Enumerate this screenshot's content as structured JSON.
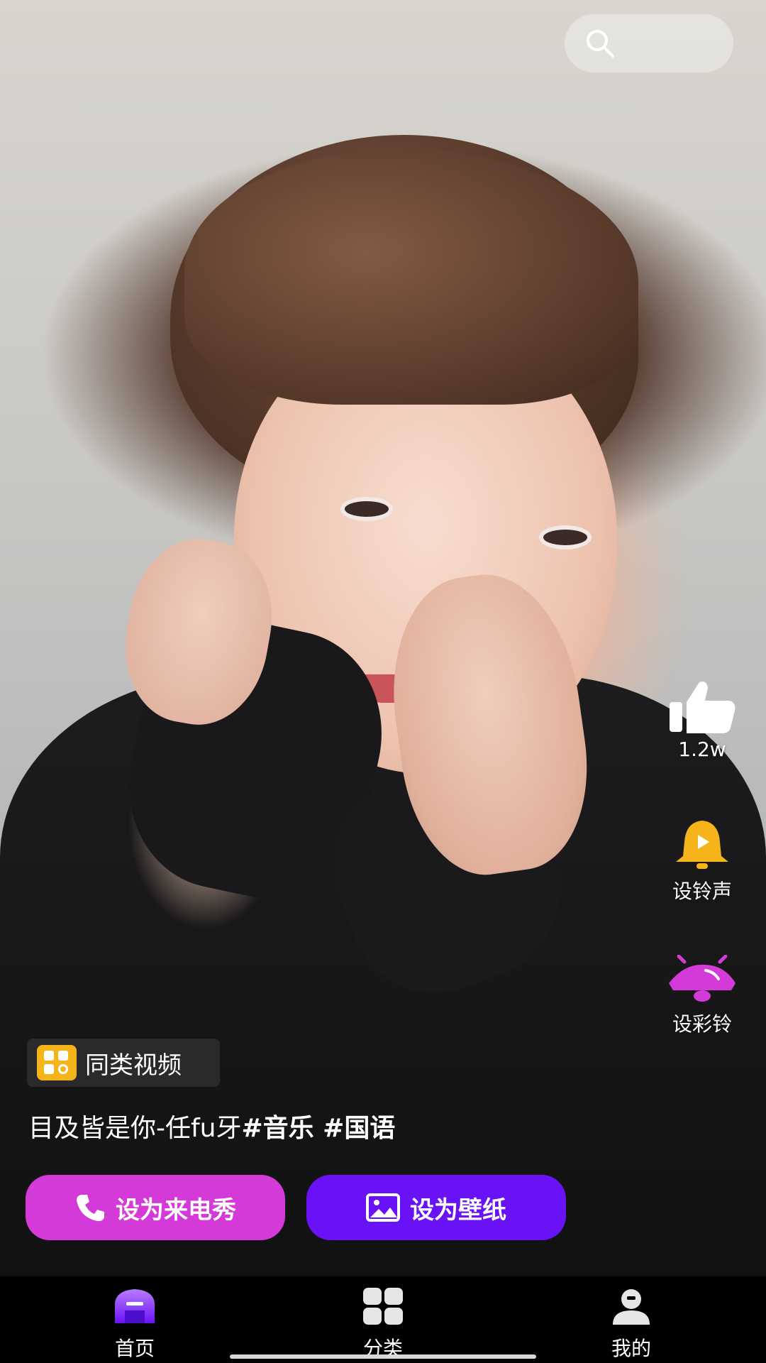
{
  "search": {
    "icon": "search-icon"
  },
  "actions": {
    "like": {
      "icon": "thumbs-up-icon",
      "count": "1.2w"
    },
    "ringtone": {
      "icon": "bell-play-icon",
      "label": "设铃声",
      "color": "#f5b51a"
    },
    "color_ring": {
      "icon": "ringing-bell-icon",
      "label": "设彩铃",
      "color": "#d43ad8"
    }
  },
  "tag": {
    "icon": "grid-icon",
    "label": "同类视频",
    "color": "#f5b51a"
  },
  "caption": {
    "title": "目及皆是你-任fu牙",
    "hashtags": "#音乐 #国语"
  },
  "buttons": {
    "call_show": {
      "icon": "phone-icon",
      "label": "设为来电秀",
      "color": "#d43ad8"
    },
    "wallpaper": {
      "icon": "image-icon",
      "label": "设为壁纸",
      "color": "#6a12f7"
    }
  },
  "nav": [
    {
      "icon": "home-icon",
      "label": "首页",
      "active": true
    },
    {
      "icon": "category-icon",
      "label": "分类",
      "active": false
    },
    {
      "icon": "profile-icon",
      "label": "我的",
      "active": false
    }
  ]
}
